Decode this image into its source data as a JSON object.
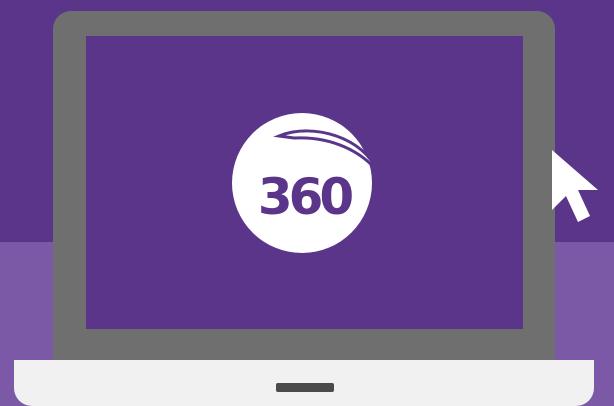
{
  "logo": {
    "text": "360",
    "circle_color": "#ffffff",
    "text_color": "#5b3589"
  },
  "colors": {
    "background_top": "#5b3589",
    "background_bottom": "#7b59a7",
    "laptop_frame": "#6f6f6f",
    "screen": "#5b3589",
    "laptop_base": "#f1f1f1",
    "trackpad_notch": "#4a4a4a",
    "cursor_fill": "#ffffff"
  },
  "icons": {
    "cursor": "mouse-pointer-icon"
  }
}
